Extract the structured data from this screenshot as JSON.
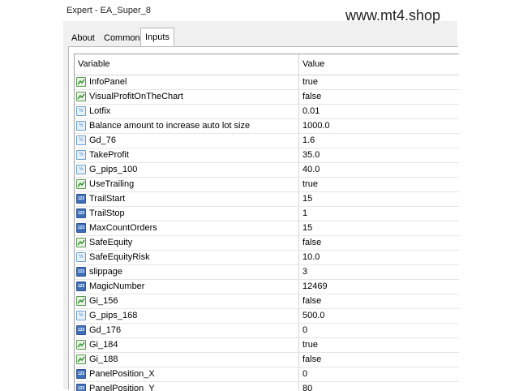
{
  "window": {
    "title": "Expert - EA_Super_8"
  },
  "watermark": "www.mt4.shop",
  "tabs": [
    {
      "label": "About",
      "active": false
    },
    {
      "label": "Common",
      "active": false
    },
    {
      "label": "Inputs",
      "active": true
    }
  ],
  "grid": {
    "headers": {
      "variable": "Variable",
      "value": "Value"
    },
    "rows": [
      {
        "name": "InfoPanel",
        "value": "true",
        "type": "bool"
      },
      {
        "name": "VisualProfitOnTheChart",
        "value": "false",
        "type": "bool"
      },
      {
        "name": "Lotfix",
        "value": "0.01",
        "type": "double"
      },
      {
        "name": "Balance amount to increase auto lot size",
        "value": "1000.0",
        "type": "double"
      },
      {
        "name": "Gd_76",
        "value": "1.6",
        "type": "double"
      },
      {
        "name": "TakeProfit",
        "value": "35.0",
        "type": "double"
      },
      {
        "name": "G_pips_100",
        "value": "40.0",
        "type": "double"
      },
      {
        "name": "UseTrailing",
        "value": "true",
        "type": "bool"
      },
      {
        "name": "TrailStart",
        "value": "15",
        "type": "int"
      },
      {
        "name": "TrailStop",
        "value": "1",
        "type": "int"
      },
      {
        "name": "MaxCountOrders",
        "value": "15",
        "type": "int"
      },
      {
        "name": "SafeEquity",
        "value": "false",
        "type": "bool"
      },
      {
        "name": "SafeEquityRisk",
        "value": "10.0",
        "type": "double"
      },
      {
        "name": "slippage",
        "value": "3",
        "type": "int"
      },
      {
        "name": "MagicNumber",
        "value": "12469",
        "type": "int"
      },
      {
        "name": "Gi_156",
        "value": "false",
        "type": "bool"
      },
      {
        "name": "G_pips_168",
        "value": "500.0",
        "type": "double"
      },
      {
        "name": "Gd_176",
        "value": "0",
        "type": "int"
      },
      {
        "name": "Gi_184",
        "value": "true",
        "type": "bool"
      },
      {
        "name": "Gi_188",
        "value": "false",
        "type": "bool"
      },
      {
        "name": "PanelPosition_X",
        "value": "0",
        "type": "int"
      },
      {
        "name": "PanelPosition_Y",
        "value": "80",
        "type": "int"
      }
    ]
  },
  "icon_glyphs": {
    "int": "123",
    "double": "½"
  }
}
